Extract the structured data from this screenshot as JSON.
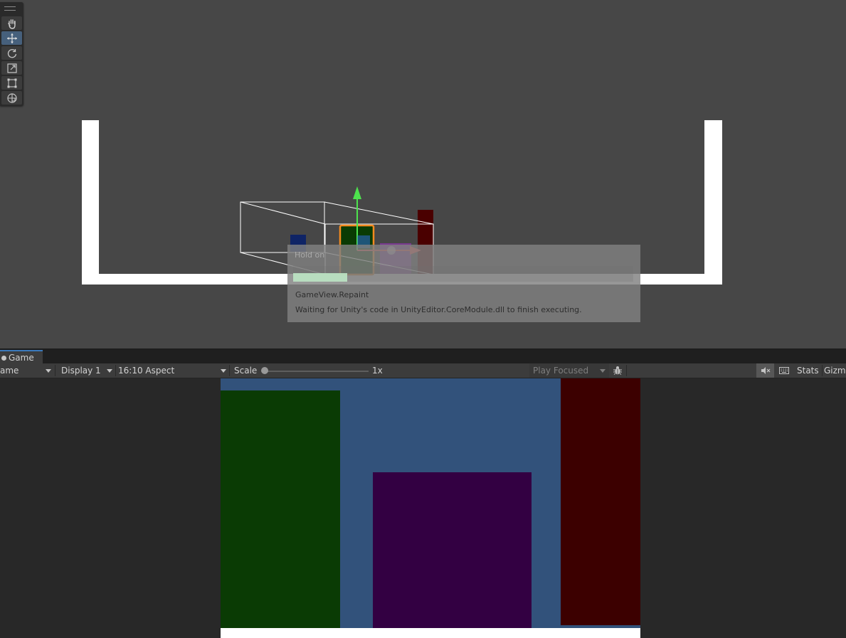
{
  "scene": {
    "progress_dialog": {
      "title": "Hold on",
      "progress": 0.16,
      "step": "GameView.Repaint",
      "detail": "Waiting for Unity's code in UnityEditor.CoreModule.dll to finish executing."
    },
    "tools": [
      {
        "name": "hand-tool",
        "icon": "hand-icon",
        "active": false
      },
      {
        "name": "move-tool",
        "icon": "move-icon",
        "active": true
      },
      {
        "name": "rotate-tool",
        "icon": "rotate-icon",
        "active": false
      },
      {
        "name": "scale-tool",
        "icon": "scale-icon",
        "active": false
      },
      {
        "name": "rect-tool",
        "icon": "rect-icon",
        "active": false
      },
      {
        "name": "transform-tool",
        "icon": "transform-icon",
        "active": false
      }
    ],
    "colors": {
      "background": "#474747",
      "walls": "#ffffff",
      "selection_outline": "#f58a1f",
      "gizmo_y": "#4de34d",
      "gizmo_x": "#e8524e"
    }
  },
  "game": {
    "tab_label": "Game",
    "toolbar": {
      "mode_label": "ame",
      "display_label": "Display 1",
      "aspect_label": "16:10 Aspect",
      "scale_label": "Scale",
      "scale_value": "1x",
      "play_mode_label": "Play Focused",
      "stats_label": "Stats",
      "gizmos_label": "Gizmo"
    },
    "colors": {
      "sky": "#32527b",
      "green_block": "#0a3b04",
      "purple_block": "#330042",
      "red_block": "#3c0000",
      "floor": "#ffffff",
      "letterbox": "#282828"
    }
  }
}
